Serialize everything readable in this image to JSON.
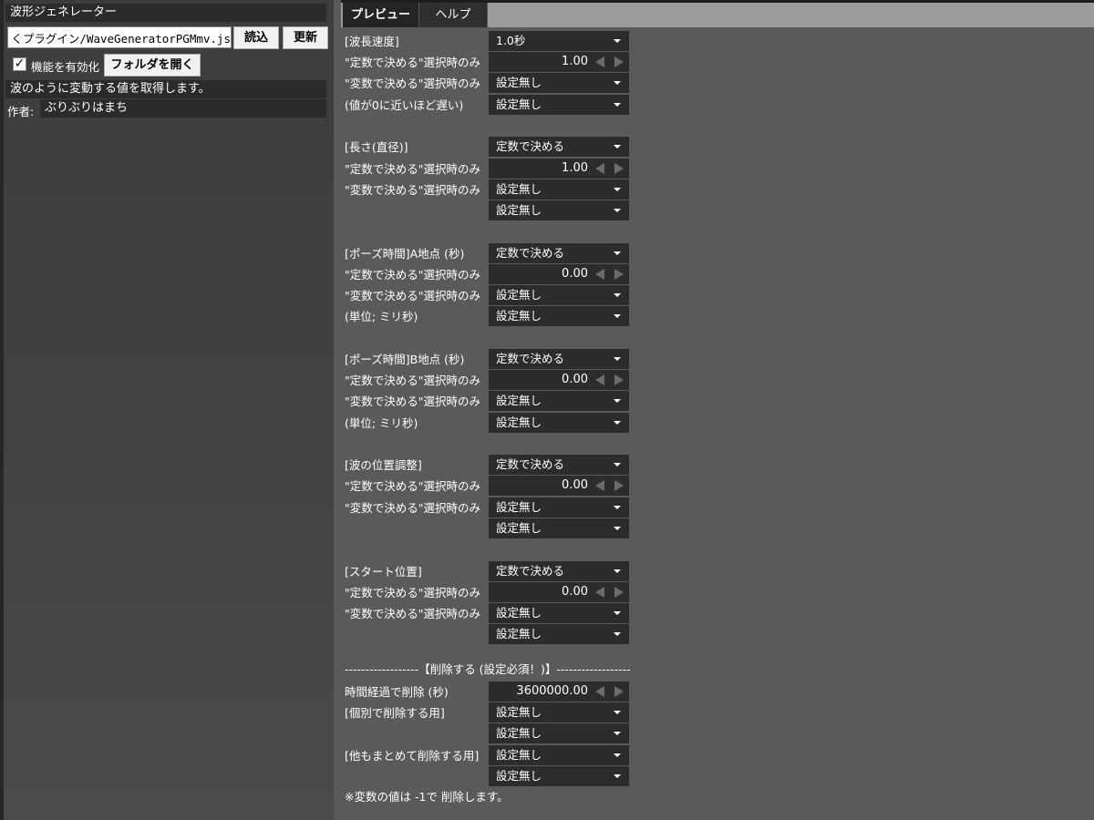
{
  "plugin": {
    "title": "波形ジェネレーター",
    "path": "さくプラグイン/WaveGeneratorPGMmv.js",
    "load_label": "読込",
    "refresh_label": "更新",
    "enable_label": "機能を有効化",
    "enabled": true,
    "open_folder_label": "フォルダを開く",
    "description": "波のように変動する値を取得します。",
    "author_label": "作者:",
    "author": "ぶりぶりはまち"
  },
  "tabs": [
    {
      "label": "プレビュー",
      "active": true
    },
    {
      "label": "ヘルプ",
      "active": false
    }
  ],
  "groups": [
    {
      "rows": [
        {
          "label": "[波長速度]",
          "type": "dropdown",
          "value": "1.0秒"
        },
        {
          "label": "\"定数で決める\"選択時のみ",
          "type": "spinner",
          "value": "1.00"
        },
        {
          "label": "\"変数で決める\"選択時のみ",
          "type": "dropdown",
          "value": "設定無し"
        },
        {
          "label": "(値が0に近いほど遅い)",
          "type": "dropdown",
          "value": "設定無し"
        }
      ]
    },
    {
      "rows": [
        {
          "label": "[長さ(直径)]",
          "type": "dropdown",
          "value": "定数で決める"
        },
        {
          "label": "\"定数で決める\"選択時のみ",
          "type": "spinner",
          "value": "1.00"
        },
        {
          "label": "\"変数で決める\"選択時のみ",
          "type": "dropdown",
          "value": "設定無し"
        },
        {
          "label": "",
          "type": "dropdown",
          "value": "設定無し"
        }
      ]
    },
    {
      "rows": [
        {
          "label": "[ポーズ時間]A地点 (秒)",
          "type": "dropdown",
          "value": "定数で決める"
        },
        {
          "label": "\"定数で決める\"選択時のみ",
          "type": "spinner",
          "value": "0.00"
        },
        {
          "label": "\"変数で決める\"選択時のみ",
          "type": "dropdown",
          "value": "設定無し"
        },
        {
          "label": "(単位; ミリ秒)",
          "type": "dropdown",
          "value": "設定無し"
        }
      ]
    },
    {
      "rows": [
        {
          "label": "[ポーズ時間]B地点 (秒)",
          "type": "dropdown",
          "value": "定数で決める"
        },
        {
          "label": "\"定数で決める\"選択時のみ",
          "type": "spinner",
          "value": "0.00"
        },
        {
          "label": "\"変数で決める\"選択時のみ",
          "type": "dropdown",
          "value": "設定無し"
        },
        {
          "label": "(単位; ミリ秒)",
          "type": "dropdown",
          "value": "設定無し"
        }
      ]
    },
    {
      "rows": [
        {
          "label": "[波の位置調整]",
          "type": "dropdown",
          "value": "定数で決める"
        },
        {
          "label": "\"定数で決める\"選択時のみ",
          "type": "spinner",
          "value": "0.00"
        },
        {
          "label": "\"変数で決める\"選択時のみ",
          "type": "dropdown",
          "value": "設定無し"
        },
        {
          "label": "",
          "type": "dropdown",
          "value": "設定無し"
        }
      ]
    },
    {
      "rows": [
        {
          "label": "[スタート位置]",
          "type": "dropdown",
          "value": "定数で決める"
        },
        {
          "label": "\"定数で決める\"選択時のみ",
          "type": "spinner",
          "value": "0.00"
        },
        {
          "label": "\"変数で決める\"選択時のみ",
          "type": "dropdown",
          "value": "設定無し"
        },
        {
          "label": "",
          "type": "dropdown",
          "value": "設定無し"
        }
      ]
    }
  ],
  "delete_section": {
    "separator": "------------------【削除する (設定必須！)】------------------",
    "rows": [
      {
        "label": "時間経過で削除 (秒)",
        "type": "spinner",
        "value": "3600000.00"
      },
      {
        "label": "[個別で削除する用]",
        "type": "dropdown",
        "value": "設定無し"
      },
      {
        "label": "",
        "type": "dropdown",
        "value": "設定無し"
      },
      {
        "label": "[他もまとめて削除する用]",
        "type": "dropdown",
        "value": "設定無し"
      },
      {
        "label": "",
        "type": "dropdown",
        "value": "設定無し"
      }
    ],
    "note": "※変数の値は -1で 削除します。"
  }
}
